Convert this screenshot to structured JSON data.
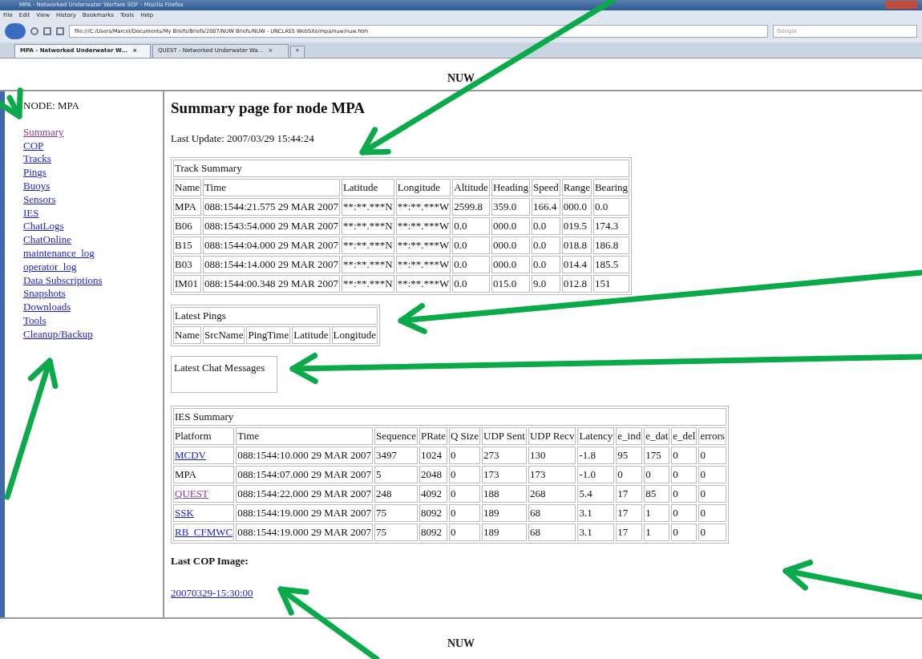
{
  "browser": {
    "title": "MPA - Networked Underwater Warfare SOF - Mozilla Firefox",
    "menu": [
      "File",
      "Edit",
      "View",
      "History",
      "Bookmarks",
      "Tools",
      "Help"
    ],
    "address": "file:///C:/Users/Marcel/Documents/My Briefs/Briefs/2007/NUW Briefs/NUW - UNCLASS WebSite/mpa/nuw/nuw.htm",
    "search_placeholder": "Google",
    "tabs": [
      {
        "label": "MPA - Networked Underwater W...",
        "selected": true
      },
      {
        "label": "QUEST - Networked Underwater Wa...",
        "selected": false
      }
    ],
    "new_tab": "+",
    "tab_close": "×"
  },
  "top_frame": {
    "title": "NUW"
  },
  "sidebar": {
    "node": "NODE: MPA",
    "links": [
      {
        "label": "Summary",
        "visited": true
      },
      {
        "label": "COP",
        "visited": false
      },
      {
        "label": "Tracks",
        "visited": false
      },
      {
        "label": "Pings",
        "visited": false
      },
      {
        "label": "Buoys",
        "visited": false
      },
      {
        "label": "Sensors",
        "visited": false
      },
      {
        "label": "IES",
        "visited": false
      },
      {
        "label": "ChatLogs",
        "visited": false
      },
      {
        "label": "ChatOnline",
        "visited": false
      },
      {
        "label": "maintenance_log",
        "visited": false
      },
      {
        "label": "operator_log",
        "visited": false
      },
      {
        "label": "Data Subscriptions",
        "visited": false
      },
      {
        "label": "Snapshots",
        "visited": false
      },
      {
        "label": "Downloads",
        "visited": false
      },
      {
        "label": "Tools",
        "visited": false
      },
      {
        "label": "Cleanup/Backup",
        "visited": false
      }
    ]
  },
  "main": {
    "heading": "Summary page for node MPA",
    "last_update": "Last Update: 2007/03/29 15:44:24",
    "track_summary": {
      "caption": "Track Summary",
      "columns": [
        "Name",
        "Time",
        "Latitude",
        "Longitude",
        "Altitude",
        "Heading",
        "Speed",
        "Range",
        "Bearing"
      ],
      "rows": [
        [
          "MPA",
          "088:1544:21.575 29 MAR 2007",
          "**:**.***N",
          "**:**.***W",
          "2599.8",
          "359.0",
          "166.4",
          "000.0",
          "0.0"
        ],
        [
          "B06",
          "088:1543:54.000 29 MAR 2007",
          "**:**.***N",
          "**:**.***W",
          "0.0",
          "000.0",
          "0.0",
          "019.5",
          "174.3"
        ],
        [
          "B15",
          "088:1544:04.000 29 MAR 2007",
          "**:**.***N",
          "**:**.***W",
          "0.0",
          "000.0",
          "0.0",
          "018.8",
          "186.8"
        ],
        [
          "B03",
          "088:1544:14.000 29 MAR 2007",
          "**:**.***N",
          "**:**.***W",
          "0.0",
          "000.0",
          "0.0",
          "014.4",
          "185.5"
        ],
        [
          "IM01",
          "088:1544:00.348 29 MAR 2007",
          "**:**.***N",
          "**:**.***W",
          "0.0",
          "015.0",
          "9.0",
          "012.8",
          "151"
        ]
      ]
    },
    "latest_pings": {
      "caption": "Latest Pings",
      "columns": [
        "Name",
        "SrcName",
        "PingTime",
        "Latitude",
        "Longitude"
      ]
    },
    "chat": {
      "caption": "Latest Chat Messages"
    },
    "ies_summary": {
      "caption": "IES Summary",
      "columns": [
        "Platform",
        "Time",
        "Sequence",
        "PRate",
        "Q Size",
        "UDP Sent",
        "UDP Recv",
        "Latency",
        "e_ind",
        "e_dat",
        "e_del",
        "errors"
      ],
      "rows": [
        {
          "link": true,
          "visited": false,
          "cells": [
            "MCDV",
            "088:1544:10.000 29 MAR 2007",
            "3497",
            "1024",
            "0",
            "273",
            "130",
            "-1.8",
            "95",
            "175",
            "0",
            "0"
          ]
        },
        {
          "link": false,
          "cells": [
            "MPA",
            "088:1544:07.000 29 MAR 2007",
            "5",
            "2048",
            "0",
            "173",
            "173",
            "-1.0",
            "0",
            "0",
            "0",
            "0"
          ]
        },
        {
          "link": true,
          "visited": true,
          "cells": [
            "QUEST",
            "088:1544:22.000 29 MAR 2007",
            "248",
            "4092",
            "0",
            "188",
            "268",
            "5.4",
            "17",
            "85",
            "0",
            "0"
          ]
        },
        {
          "link": true,
          "visited": false,
          "cells": [
            "SSK",
            "088:1544:19.000 29 MAR 2007",
            "75",
            "8092",
            "0",
            "189",
            "68",
            "3.1",
            "17",
            "1",
            "0",
            "0"
          ]
        },
        {
          "link": true,
          "visited": false,
          "cells": [
            "RB_CFMWC",
            "088:1544:19.000 29 MAR 2007",
            "75",
            "8092",
            "0",
            "189",
            "68",
            "3.1",
            "17",
            "1",
            "0",
            "0"
          ]
        }
      ]
    },
    "cop_label": "Last COP Image:",
    "cop_link": "20070329-15:30:00"
  },
  "bottom_frame": {
    "title": "NUW"
  }
}
